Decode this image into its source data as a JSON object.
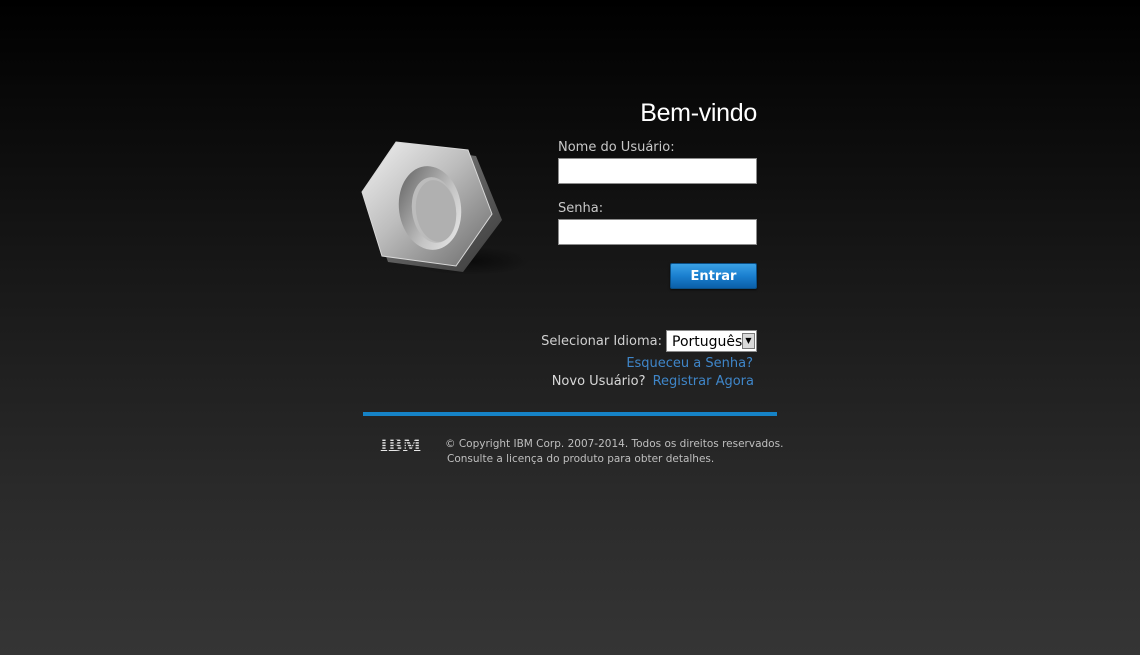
{
  "login": {
    "welcome_title": "Bem-vindo",
    "username_label": "Nome do Usuário:",
    "username_value": "",
    "password_label": "Senha:",
    "password_value": "",
    "submit_label": "Entrar"
  },
  "language": {
    "label": "Selecionar Idioma:",
    "selected": "Português"
  },
  "links": {
    "forgot_password": "Esqueceu a Senha?",
    "new_user_label": "Novo Usuário?",
    "register": "Registrar Agora"
  },
  "footer": {
    "logo_text": "IBM",
    "copyright_line1": "© Copyright IBM Corp. 2007-2014. Todos os direitos reservados.",
    "copyright_line2": "Consulte a licença do produto para obter detalhes."
  },
  "colors": {
    "accent": "#1683c6",
    "link": "#3f86c9",
    "button": "#1a7fcf"
  },
  "icons": {
    "product_logo": "hex-nut-icon",
    "brand_logo": "ibm-logo",
    "dropdown": "dropdown-arrow-icon"
  }
}
